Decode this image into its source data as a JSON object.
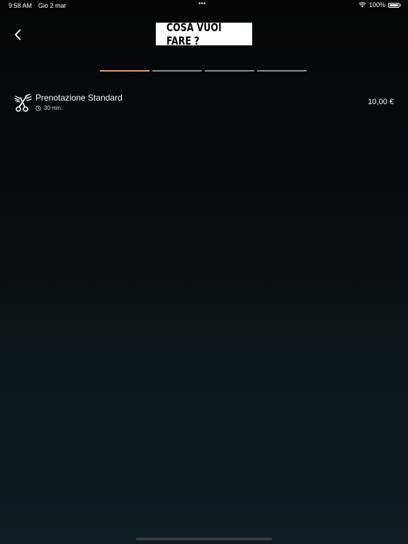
{
  "status_bar": {
    "time": "9:58 AM",
    "date": "Gio 2 mar",
    "battery": "100%",
    "battery_level": 1.0
  },
  "header": {
    "title": "COSA VUOI FARE ?"
  },
  "progress": {
    "total_steps": 4,
    "current_step": 1,
    "active_color": "#e0a17b",
    "inactive_color": "#8a8a8a"
  },
  "services": [
    {
      "name": "Prenotazione Standard",
      "duration": "30 min.",
      "price": "10,00 €",
      "icon": "scissors-comb-icon"
    }
  ]
}
